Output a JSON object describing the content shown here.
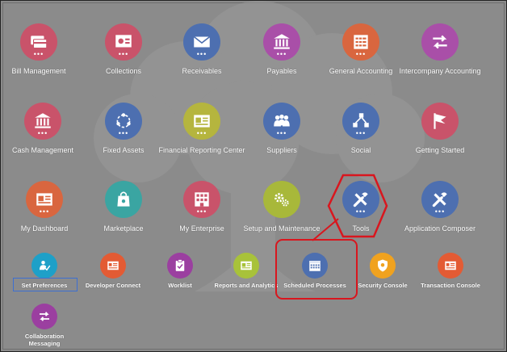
{
  "tiles": [
    {
      "label": "Bill Management",
      "color": "#c9536a",
      "icon": "credit-cards-icon"
    },
    {
      "label": "Collections",
      "color": "#c9536a",
      "icon": "collections-icon"
    },
    {
      "label": "Receivables",
      "color": "#4d6fb0",
      "icon": "envelope-icon"
    },
    {
      "label": "Payables",
      "color": "#a94fa8",
      "icon": "bank-icon"
    },
    {
      "label": "General Accounting",
      "color": "#d9663f",
      "icon": "ledger-icon"
    },
    {
      "label": "Intercompany Accounting",
      "color": "#a94fa8",
      "icon": "exchange-arrows-icon"
    },
    {
      "label": "Cash Management",
      "color": "#c9536a",
      "icon": "bank-icon"
    },
    {
      "label": "Fixed Assets",
      "color": "#4d6fb0",
      "icon": "assets-cycle-icon"
    },
    {
      "label": "Financial Reporting Center",
      "color": "#b5b53e",
      "icon": "report-icon"
    },
    {
      "label": "Suppliers",
      "color": "#4d6fb0",
      "icon": "people-group-icon"
    },
    {
      "label": "Social",
      "color": "#4d6fb0",
      "icon": "social-network-icon"
    },
    {
      "label": "Getting Started",
      "color": "#c9536a",
      "icon": "flag-icon"
    },
    {
      "label": "My Dashboard",
      "color": "#d9663f",
      "icon": "dashboard-icon"
    },
    {
      "label": "Marketplace",
      "color": "#3aa5a2",
      "icon": "shopping-bag-icon"
    },
    {
      "label": "My Enterprise",
      "color": "#c9536a",
      "icon": "building-icon"
    },
    {
      "label": "Setup and Maintenance",
      "color": "#a8b83a",
      "icon": "gears-icon"
    },
    {
      "label": "Tools",
      "color": "#4d6fb0",
      "icon": "tools-icon"
    },
    {
      "label": "Application Composer",
      "color": "#4d6fb0",
      "icon": "tools-icon"
    }
  ],
  "small_tiles": [
    {
      "label": "Set Preferences",
      "color": "#1ea0c8",
      "icon": "person-check-icon"
    },
    {
      "label": "Developer Connect",
      "color": "#e35b34",
      "icon": "id-card-icon"
    },
    {
      "label": "Worklist",
      "color": "#9b3fa0",
      "icon": "clipboard-check-icon"
    },
    {
      "label": "Reports and Analytics",
      "color": "#a8c23a",
      "icon": "report-icon"
    },
    {
      "label": "Scheduled Processes",
      "color": "#4d6fb0",
      "icon": "calendar-icon"
    },
    {
      "label": "Security Console",
      "color": "#f0a21f",
      "icon": "shield-icon"
    },
    {
      "label": "Transaction Console",
      "color": "#e35b34",
      "icon": "id-card-icon"
    },
    {
      "label": "Collaboration Messaging",
      "color": "#9b3fa0",
      "icon": "exchange-arrows-icon"
    }
  ],
  "colors": {
    "background": "#8b8b8b",
    "highlight": "#d9161e"
  }
}
